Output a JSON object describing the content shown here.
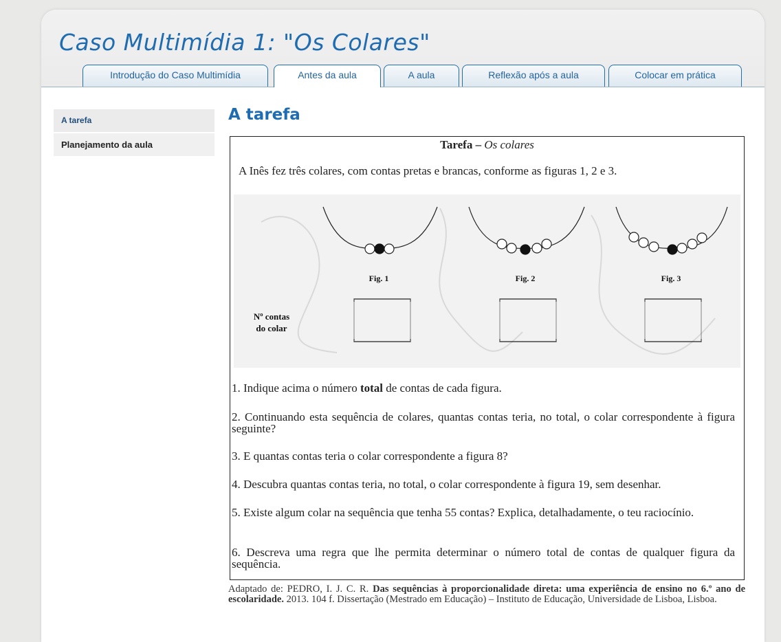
{
  "header": {
    "title": "Caso Multimídia 1: \"Os Colares\""
  },
  "tabs": [
    {
      "label": "Introdução do Caso Multimídia"
    },
    {
      "label": "Antes da aula"
    },
    {
      "label": "A aula"
    },
    {
      "label": "Reflexão após a aula"
    },
    {
      "label": "Colocar em prática"
    }
  ],
  "active_tab": "Antes da aula",
  "sidebar": {
    "items": [
      {
        "label": "A tarefa"
      },
      {
        "label": "Planejamento da aula"
      }
    ]
  },
  "main": {
    "title": "A tarefa",
    "task": {
      "title_prefix": "Tarefa – ",
      "title_italic": "Os colares",
      "intro": "A Inês fez três colares, com contas pretas e brancas, conforme as figuras 1, 2 e 3.",
      "figures": [
        {
          "label": "Fig. 1"
        },
        {
          "label": "Fig. 2"
        },
        {
          "label": "Fig. 3"
        }
      ],
      "count_label_line1": "Nº contas",
      "count_label_line2": "do colar",
      "questions": [
        {
          "prefix": "1. Indique acima o número ",
          "bold": "total",
          "suffix": " de contas de cada figura."
        },
        {
          "text": "2. Continuando esta sequência de colares, quantas contas teria, no total, o colar correspondente à figura seguinte?"
        },
        {
          "text": "3. E quantas contas teria o colar correspondente a figura 8?"
        },
        {
          "text": "4. Descubra quantas contas teria, no total, o colar correspondente à figura 19, sem desenhar."
        },
        {
          "text": "5. Existe algum colar na sequência que tenha 55 contas? Explica, detalhadamente, o teu raciocínio."
        },
        {
          "text": "6. Descreva uma regra que lhe permita determinar o número total de contas de qualquer figura da sequência."
        }
      ]
    },
    "citation": {
      "prefix": "Adaptado de: PEDRO, I. J. C. R. ",
      "bold": "Das sequências à proporcionalidade direta: uma experiência de ensino no 6.º ano de escolaridade.",
      "suffix": " 2013. 104 f. Dissertação (Mestrado em Educação) – Instituto de Educação, Universidade de Lisboa, Lisboa."
    }
  },
  "colors": {
    "accent": "#1f6cb0",
    "tab_border": "#1e6fae"
  }
}
